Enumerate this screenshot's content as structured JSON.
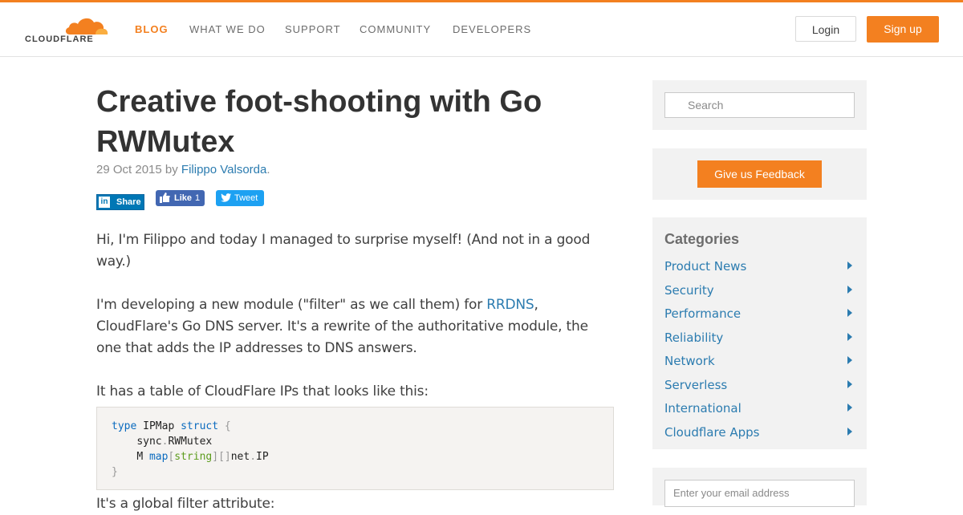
{
  "brand": {
    "name": "CLOUDFLARE",
    "accent": "#f38020",
    "link": "#2c7cb0"
  },
  "nav": {
    "items": [
      {
        "label": "BLOG",
        "active": true
      },
      {
        "label": "WHAT WE DO",
        "active": false
      },
      {
        "label": "SUPPORT",
        "active": false
      },
      {
        "label": "COMMUNITY",
        "active": false
      },
      {
        "label": "DEVELOPERS",
        "active": false
      }
    ],
    "login_label": "Login",
    "signup_label": "Sign up"
  },
  "post": {
    "title": "Creative foot-shooting with Go RWMutex",
    "date": "29 Oct 2015",
    "by": "by",
    "author": "Filippo Valsorda",
    "author_suffix": ".",
    "share": {
      "linkedin_label": "Share",
      "facebook_label": "Like",
      "facebook_count": "1",
      "twitter_label": "Tweet"
    },
    "p1": "Hi, I'm Filippo and today I managed to surprise myself! (And not in a good way.)",
    "p2_before": "I'm developing a new module (\"filter\" as we call them) for ",
    "p2_link": "RRDNS",
    "p2_after": ", CloudFlare's Go DNS server. It's a rewrite of the authoritative module, the one that adds the IP addresses to DNS answers.",
    "p3": "It has a table of CloudFlare IPs that looks like this:",
    "p4": "It's a global filter attribute:",
    "code": {
      "kw_type": "type",
      "name": "IPMap",
      "kw_struct": "struct",
      "brace_open": "{",
      "field1": "sync",
      "dot": ".",
      "field1_type": "RWMutex",
      "field2": "M",
      "kw_map": "map",
      "lbrack": "[",
      "kw_string": "string",
      "rbrack_slice": "][]",
      "pkg": "net",
      "ip": "IP",
      "brace_close": "}"
    }
  },
  "sidebar": {
    "search_placeholder": "Search",
    "feedback_label": "Give us Feedback",
    "categories_title": "Categories",
    "categories": [
      "Product News",
      "Security",
      "Performance",
      "Reliability",
      "Network",
      "Serverless",
      "International",
      "Cloudflare Apps"
    ],
    "email_placeholder": "Enter your email address"
  }
}
